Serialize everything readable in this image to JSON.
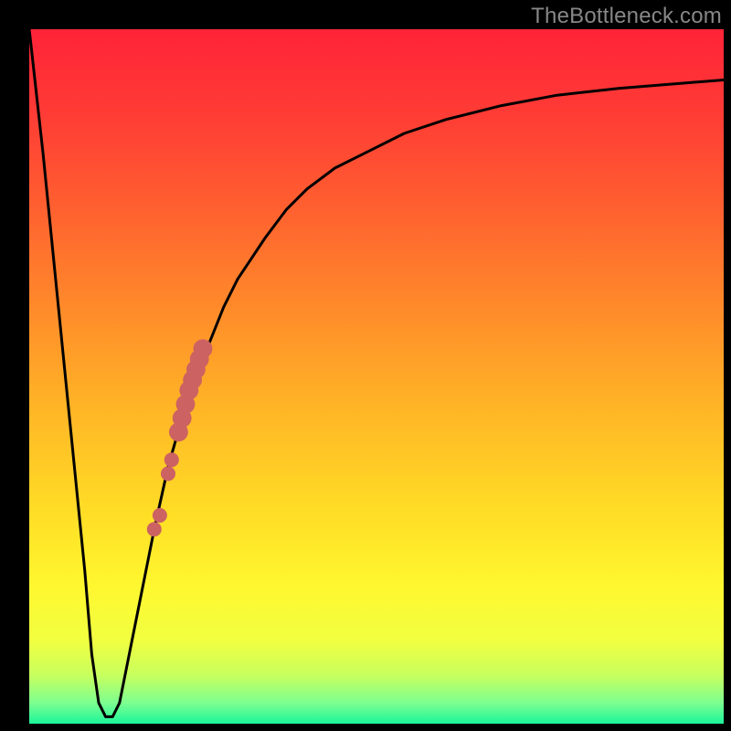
{
  "watermark": "TheBottleneck.com",
  "colors": {
    "frame": "#000000",
    "curve": "#000000",
    "dots": "#cc6262",
    "gradient_stops": [
      {
        "offset": 0.0,
        "color": "#ff2338"
      },
      {
        "offset": 0.12,
        "color": "#ff3b35"
      },
      {
        "offset": 0.25,
        "color": "#ff5e30"
      },
      {
        "offset": 0.4,
        "color": "#ff8a2a"
      },
      {
        "offset": 0.55,
        "color": "#ffb626"
      },
      {
        "offset": 0.7,
        "color": "#ffde26"
      },
      {
        "offset": 0.8,
        "color": "#fff72f"
      },
      {
        "offset": 0.88,
        "color": "#f1ff40"
      },
      {
        "offset": 0.93,
        "color": "#c8ff5e"
      },
      {
        "offset": 0.97,
        "color": "#7dff90"
      },
      {
        "offset": 1.0,
        "color": "#1cf59a"
      }
    ]
  },
  "chart_data": {
    "type": "line",
    "title": "",
    "xlabel": "",
    "ylabel": "",
    "xlim": [
      0,
      100
    ],
    "ylim": [
      0,
      100
    ],
    "series": [
      {
        "name": "bottleneck-curve",
        "x": [
          0,
          2,
          4,
          6,
          8,
          9,
          10,
          11,
          12,
          13,
          14,
          16,
          18,
          20,
          22,
          24,
          26,
          28,
          30,
          32,
          34,
          37,
          40,
          44,
          48,
          54,
          60,
          68,
          76,
          85,
          95,
          100
        ],
        "y": [
          100,
          82,
          62,
          42,
          22,
          10,
          3,
          1,
          1,
          3,
          8,
          18,
          28,
          37,
          44,
          50,
          55,
          60,
          64,
          67,
          70,
          74,
          77,
          80,
          82,
          85,
          87,
          89,
          90.5,
          91.5,
          92.3,
          92.7
        ]
      }
    ],
    "marker_series": {
      "name": "highlight-dots",
      "points": [
        {
          "x": 18.0,
          "y": 28.0,
          "r": 1.0
        },
        {
          "x": 18.8,
          "y": 30.0,
          "r": 1.0
        },
        {
          "x": 20.0,
          "y": 36.0,
          "r": 1.0
        },
        {
          "x": 20.5,
          "y": 38.0,
          "r": 1.0
        },
        {
          "x": 21.5,
          "y": 42.0,
          "r": 1.3
        },
        {
          "x": 22.0,
          "y": 44.0,
          "r": 1.3
        },
        {
          "x": 22.5,
          "y": 46.0,
          "r": 1.3
        },
        {
          "x": 23.0,
          "y": 48.0,
          "r": 1.3
        },
        {
          "x": 23.5,
          "y": 49.5,
          "r": 1.3
        },
        {
          "x": 24.0,
          "y": 51.0,
          "r": 1.3
        },
        {
          "x": 24.5,
          "y": 52.5,
          "r": 1.3
        },
        {
          "x": 25.0,
          "y": 54.0,
          "r": 1.3
        }
      ]
    }
  }
}
